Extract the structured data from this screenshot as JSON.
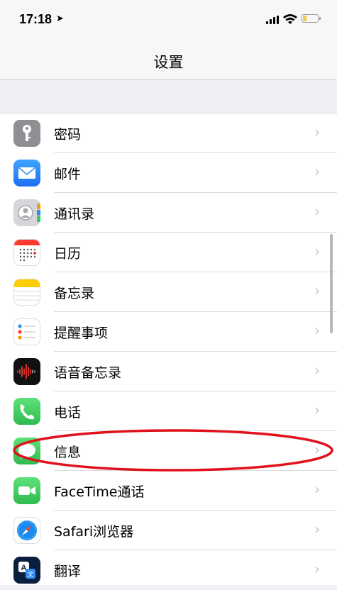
{
  "status": {
    "time": "17:18"
  },
  "nav": {
    "title": "设置"
  },
  "items": [
    {
      "label": "密码",
      "icon": "key-icon",
      "color": "#8e8e93"
    },
    {
      "label": "邮件",
      "icon": "mail-icon",
      "color": "#2f8df5"
    },
    {
      "label": "通讯录",
      "icon": "contacts-icon",
      "color": "#c9c9ce"
    },
    {
      "label": "日历",
      "icon": "calendar-icon",
      "color": "#ffffff"
    },
    {
      "label": "备忘录",
      "icon": "notes-icon",
      "color": "#ffffff"
    },
    {
      "label": "提醒事项",
      "icon": "reminders-icon",
      "color": "#ffffff"
    },
    {
      "label": "语音备忘录",
      "icon": "voice-memos-icon",
      "color": "#111111"
    },
    {
      "label": "电话",
      "icon": "phone-icon",
      "color": "#35c759"
    },
    {
      "label": "信息",
      "icon": "messages-icon",
      "color": "#35c759"
    },
    {
      "label": "FaceTime通话",
      "icon": "facetime-icon",
      "color": "#35c759"
    },
    {
      "label": "Safari浏览器",
      "icon": "safari-icon",
      "color": "#ffffff"
    },
    {
      "label": "翻译",
      "icon": "translate-icon",
      "color": "#0a1f3d"
    }
  ],
  "annotation_color": "#e0121b"
}
